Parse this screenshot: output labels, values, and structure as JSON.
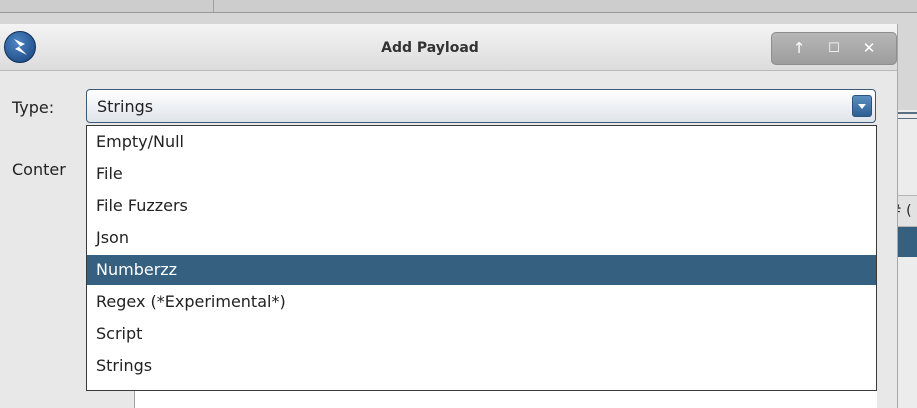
{
  "dialog": {
    "title": "Add Payload",
    "window_buttons": [
      "↑",
      "☐",
      "✕"
    ]
  },
  "form": {
    "type_label": "Type:",
    "content_label": "Conter",
    "type_value": "Strings"
  },
  "dropdown": {
    "options": [
      "Empty/Null",
      "File",
      "File Fuzzers",
      "Json",
      "Numberzz",
      "Regex (*Experimental*)",
      "Script",
      "Strings"
    ],
    "highlighted": "Numberzz"
  },
  "background": {
    "column_header_fragment": "# ("
  },
  "colors": {
    "selection": "#35607f",
    "accent": "#2f5f92"
  },
  "icons": {
    "app": "zap-logo-icon",
    "dropdown_arrow": "chevron-down-icon"
  }
}
